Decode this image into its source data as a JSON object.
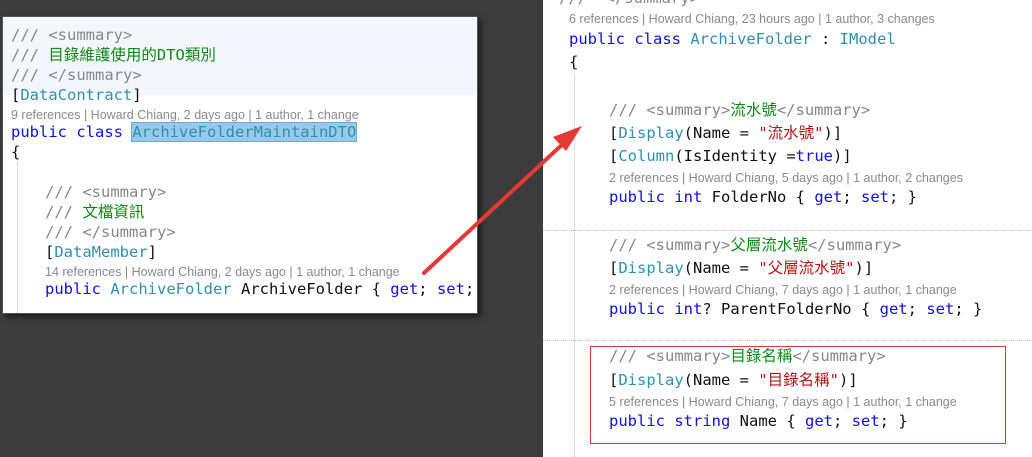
{
  "left_editor": {
    "summary_open": "/// <summary>",
    "summary_prefix": "/// ",
    "summary_text": "目錄維護使用的DTO類別",
    "summary_close": "/// </summary>",
    "attr_open": "[",
    "attr_name": "DataContract",
    "attr_close": "]",
    "class_lens": "9 references | Howard Chiang, 2 days ago | 1 author, 1 change",
    "class_kw": "public class ",
    "class_name": "ArchiveFolderMaintainDTO",
    "brace_open": "{",
    "member_summary_open": "/// <summary>",
    "member_summary_prefix": "/// ",
    "member_summary_text": "文檔資訊",
    "member_summary_close": "/// </summary>",
    "member_attr_open": "[",
    "member_attr": "DataMember",
    "member_attr_close": "]",
    "member_lens": "14 references | Howard Chiang, 2 days ago | 1 author, 1 change",
    "member_public": "public ",
    "member_type": "ArchiveFolder",
    "member_name": " ArchiveFolder { ",
    "get": "get",
    "sep": "; ",
    "set": "set",
    "member_end": "; }"
  },
  "right_editor": {
    "top_partial": "///  </summary>",
    "class_lens": "6 references | Howard Chiang, 23 hours ago | 1 author, 3 changes",
    "class_kw": "public class ",
    "class_name": "ArchiveFolder",
    "class_colon": " : ",
    "class_iface": "IModel",
    "brace_open": "{",
    "p1_summary_open": "/// <summary>",
    "p1_summary_text": "流水號",
    "p1_summary_close": "</summary>",
    "p1_display_pre": "[",
    "p1_display_attr": "Display",
    "p1_display_mid": "(Name = ",
    "p1_display_str": "\"流水號\"",
    "p1_display_end": ")]",
    "p1_column_pre": "[",
    "p1_column_attr": "Column",
    "p1_column_mid": "(IsIdentity =",
    "p1_column_kw": "true",
    "p1_column_end": ")]",
    "p1_lens": "2 references | Howard Chiang, 5 days ago | 1 author, 2 changes",
    "p1_public": "public ",
    "p1_type": "int",
    "p1_name": " FolderNo { ",
    "p2_summary_open": "/// <summary>",
    "p2_summary_text": "父層流水號",
    "p2_summary_close": "</summary>",
    "p2_display_pre": "[",
    "p2_display_attr": "Display",
    "p2_display_mid": "(Name = ",
    "p2_display_str": "\"父層流水號\"",
    "p2_display_end": ")]",
    "p2_lens": "2 references | Howard Chiang, 7 days ago | 1 author, 1 change",
    "p2_public": "public ",
    "p2_type": "int",
    "p2_name": "? ParentFolderNo { ",
    "p3_summary_open": "/// <summary>",
    "p3_summary_text": "目錄名稱",
    "p3_summary_close": "</summary>",
    "p3_display_pre": "[",
    "p3_display_attr": "Display",
    "p3_display_mid": "(Name = ",
    "p3_display_str": "\"目錄名稱\"",
    "p3_display_end": ")]",
    "p3_lens": "5 references | Howard Chiang, 7 days ago | 1 author, 1 change",
    "p3_public": "public ",
    "p3_type": "string",
    "p3_name": " Name { ",
    "get": "get",
    "sep": "; ",
    "set": "set",
    "member_end": "; }"
  },
  "colors": {
    "keyword": "#1010e0",
    "type": "#2b91af",
    "comment_text": "#0a8a16",
    "string": "#b31515",
    "arrow": "#e53935",
    "highlight_box": "#d93838"
  }
}
